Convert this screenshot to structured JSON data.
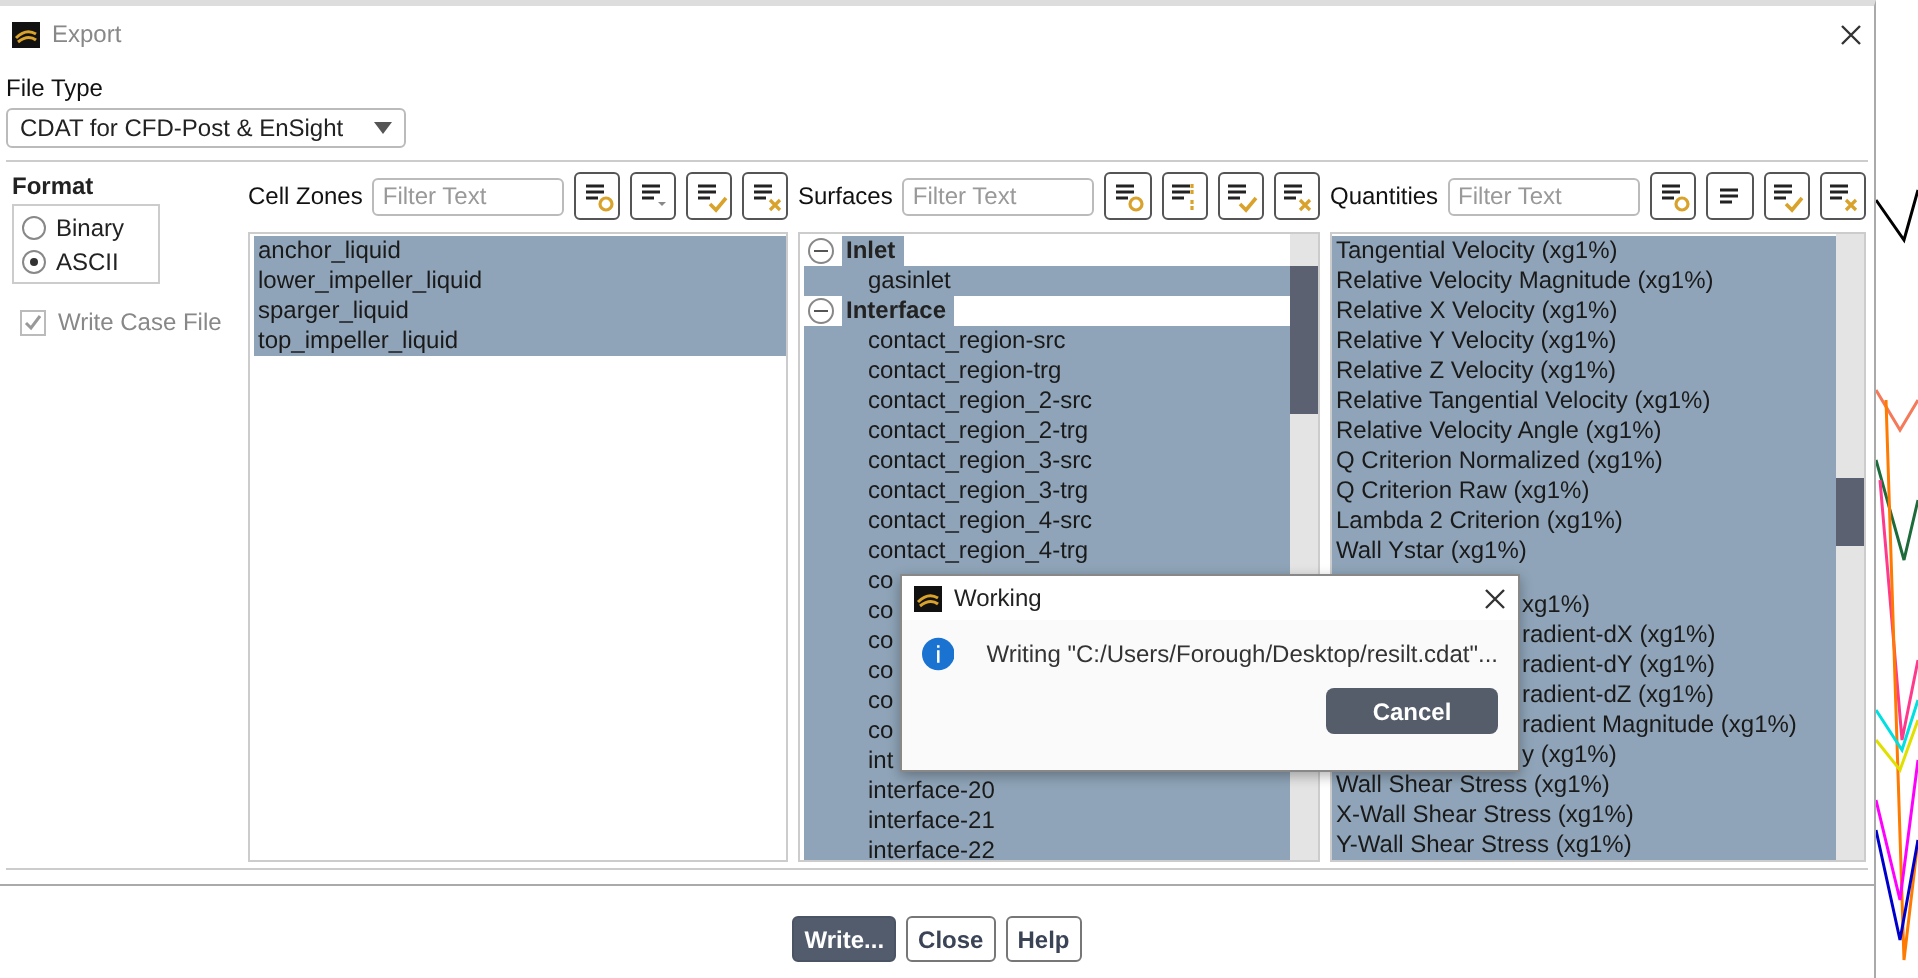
{
  "window": {
    "title": "Export"
  },
  "file_type": {
    "label": "File Type",
    "value": "CDAT for CFD-Post & EnSight"
  },
  "format": {
    "title": "Format",
    "options": [
      {
        "label": "Binary",
        "selected": false
      },
      {
        "label": "ASCII",
        "selected": true
      }
    ]
  },
  "write_case_file": {
    "label": "Write Case File",
    "checked": true,
    "disabled": true
  },
  "cell_zones": {
    "label": "Cell Zones",
    "placeholder": "Filter Text",
    "items": [
      {
        "text": "anchor_liquid",
        "selected": true
      },
      {
        "text": "lower_impeller_liquid",
        "selected": true
      },
      {
        "text": "sparger_liquid",
        "selected": true
      },
      {
        "text": "top_impeller_liquid",
        "selected": true
      }
    ]
  },
  "surfaces": {
    "label": "Surfaces",
    "placeholder": "Filter Text",
    "groups": [
      {
        "text": "Inlet",
        "expanded": true,
        "selected": true,
        "children": [
          {
            "text": "gasinlet",
            "selected": true
          }
        ]
      },
      {
        "text": "Interface",
        "expanded": true,
        "selected": true,
        "children": [
          {
            "text": "contact_region-src",
            "selected": true
          },
          {
            "text": "contact_region-trg",
            "selected": true
          },
          {
            "text": "contact_region_2-src",
            "selected": true
          },
          {
            "text": "contact_region_2-trg",
            "selected": true
          },
          {
            "text": "contact_region_3-src",
            "selected": true
          },
          {
            "text": "contact_region_3-trg",
            "selected": true
          },
          {
            "text": "contact_region_4-src",
            "selected": true
          },
          {
            "text": "contact_region_4-trg",
            "selected": true
          },
          {
            "text": "co",
            "selected": true
          },
          {
            "text": "co",
            "selected": true
          },
          {
            "text": "co",
            "selected": true
          },
          {
            "text": "co",
            "selected": true
          },
          {
            "text": "co",
            "selected": true
          },
          {
            "text": "co",
            "selected": true
          },
          {
            "text": "int",
            "selected": true
          },
          {
            "text": "interface-20",
            "selected": true
          },
          {
            "text": "interface-21",
            "selected": true
          },
          {
            "text": "interface-22",
            "selected": true
          }
        ]
      }
    ]
  },
  "quantities": {
    "label": "Quantities",
    "placeholder": "Filter Text",
    "items": [
      {
        "text": "Tangential Velocity (xg1%)",
        "selected": true,
        "kind": "full"
      },
      {
        "text": "Relative Velocity Magnitude (xg1%)",
        "selected": true,
        "kind": "full"
      },
      {
        "text": "Relative X Velocity (xg1%)",
        "selected": true,
        "kind": "full"
      },
      {
        "text": "Relative Y Velocity (xg1%)",
        "selected": true,
        "kind": "full"
      },
      {
        "text": "Relative Z Velocity (xg1%)",
        "selected": true,
        "kind": "full"
      },
      {
        "text": "Relative Tangential Velocity (xg1%)",
        "selected": true,
        "kind": "full"
      },
      {
        "text": "Relative Velocity Angle (xg1%)",
        "selected": true,
        "kind": "full"
      },
      {
        "text": "Q Criterion Normalized (xg1%)",
        "selected": true,
        "kind": "full"
      },
      {
        "text": "Q Criterion Raw (xg1%)",
        "selected": true,
        "kind": "full"
      },
      {
        "text": "Lambda 2 Criterion (xg1%)",
        "selected": true,
        "kind": "full"
      },
      {
        "text": "Wall Ystar (xg1%)",
        "selected": true,
        "kind": "full"
      },
      {
        "selected": true,
        "kind": "covered"
      },
      {
        "text": "xg1%)",
        "selected": true,
        "kind": "partial"
      },
      {
        "text": "radient-dX (xg1%)",
        "selected": true,
        "kind": "partial"
      },
      {
        "text": "radient-dY (xg1%)",
        "selected": true,
        "kind": "partial"
      },
      {
        "text": "radient-dZ (xg1%)",
        "selected": true,
        "kind": "partial"
      },
      {
        "text": "radient Magnitude (xg1%)",
        "selected": true,
        "kind": "partial"
      },
      {
        "text": "y (xg1%)",
        "selected": true,
        "kind": "partial"
      },
      {
        "text": "Wall Shear Stress (xg1%)",
        "selected": true,
        "kind": "full"
      },
      {
        "text": "X-Wall Shear Stress (xg1%)",
        "selected": true,
        "kind": "full"
      },
      {
        "text": "Y-Wall Shear Stress (xg1%)",
        "selected": true,
        "kind": "full"
      }
    ]
  },
  "working_dialog": {
    "title": "Working",
    "message": "Writing \"C:/Users/Forough/Desktop/resilt.cdat\"...",
    "button": "Cancel"
  },
  "buttons": [
    {
      "label": "Write...",
      "kind": "primary"
    },
    {
      "label": "Close",
      "kind": "normal"
    },
    {
      "label": "Help",
      "kind": "normal"
    }
  ]
}
